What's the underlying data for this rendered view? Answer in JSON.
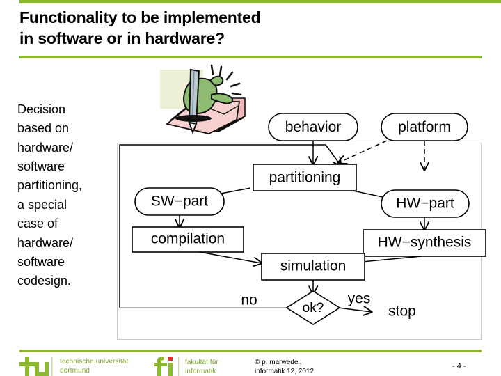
{
  "slide": {
    "title_lines": [
      "Functionality to be implemented",
      "in software or in hardware?"
    ],
    "body_lines": [
      "Decision",
      "based on",
      "hardware/",
      "software",
      "partitioning,",
      "a special",
      "case of",
      "hardware/",
      "software",
      "codesign."
    ],
    "page_number": "- 4 -",
    "accent_color": "#8cb832",
    "logo_text_color": "#7ea82a",
    "accent_red": "#e0352b"
  },
  "clipart": {
    "name": "hand-writing-with-pencil-on-paper",
    "colors": {
      "hand": "#8fbc72",
      "hand_dark": "#5f9148",
      "pencil": "#b9c7cf",
      "paper": "#f6cfcf",
      "paper_back": "#efb9b9",
      "glow": "#eef0d6"
    }
  },
  "diagram": {
    "nodes": [
      {
        "id": "behavior",
        "label": "behavior",
        "shape": "rounded"
      },
      {
        "id": "platform",
        "label": "platform",
        "shape": "rounded"
      },
      {
        "id": "partitioning",
        "label": "partitioning",
        "shape": "rect"
      },
      {
        "id": "sw_part",
        "label": "SW−part",
        "shape": "rounded"
      },
      {
        "id": "hw_part",
        "label": "HW−part",
        "shape": "rounded"
      },
      {
        "id": "compilation",
        "label": "compilation",
        "shape": "rect"
      },
      {
        "id": "hw_synthesis",
        "label": "HW−synthesis",
        "shape": "rect"
      },
      {
        "id": "simulation",
        "label": "simulation",
        "shape": "rect"
      },
      {
        "id": "ok",
        "label": "ok?",
        "shape": "diamond"
      }
    ],
    "free_labels": [
      {
        "id": "no",
        "label": "no"
      },
      {
        "id": "yes",
        "label": "yes"
      },
      {
        "id": "stop",
        "label": "stop"
      }
    ],
    "edges": [
      {
        "from": "behavior",
        "to": "partitioning",
        "style": "solid"
      },
      {
        "from": "platform",
        "to": "partitioning",
        "style": "dashed"
      },
      {
        "from": "platform",
        "to": "hw_part",
        "style": "dashed"
      },
      {
        "from": "partitioning",
        "to": "sw_part",
        "style": "solid"
      },
      {
        "from": "partitioning",
        "to": "hw_part",
        "style": "solid"
      },
      {
        "from": "sw_part",
        "to": "compilation",
        "style": "solid"
      },
      {
        "from": "hw_part",
        "to": "hw_synthesis",
        "style": "solid"
      },
      {
        "from": "compilation",
        "to": "simulation",
        "style": "solid"
      },
      {
        "from": "hw_synthesis",
        "to": "simulation",
        "style": "solid"
      },
      {
        "from": "simulation",
        "to": "ok",
        "style": "solid"
      },
      {
        "from": "ok",
        "to": "partitioning",
        "style": "solid",
        "label": "no"
      },
      {
        "from": "ok",
        "to": "stop",
        "style": "solid",
        "label": "yes"
      }
    ]
  },
  "footer": {
    "tu_logo": {
      "mark": "tu-dortmund-mark",
      "lines": [
        "technische universität",
        "dortmund"
      ]
    },
    "fi_logo": {
      "mark": "fakultaet-informatik-mark",
      "lines": [
        "fakultät für",
        "informatik"
      ]
    },
    "copyright_lines": [
      "© p. marwedel,",
      "informatik 12,  2012"
    ]
  }
}
